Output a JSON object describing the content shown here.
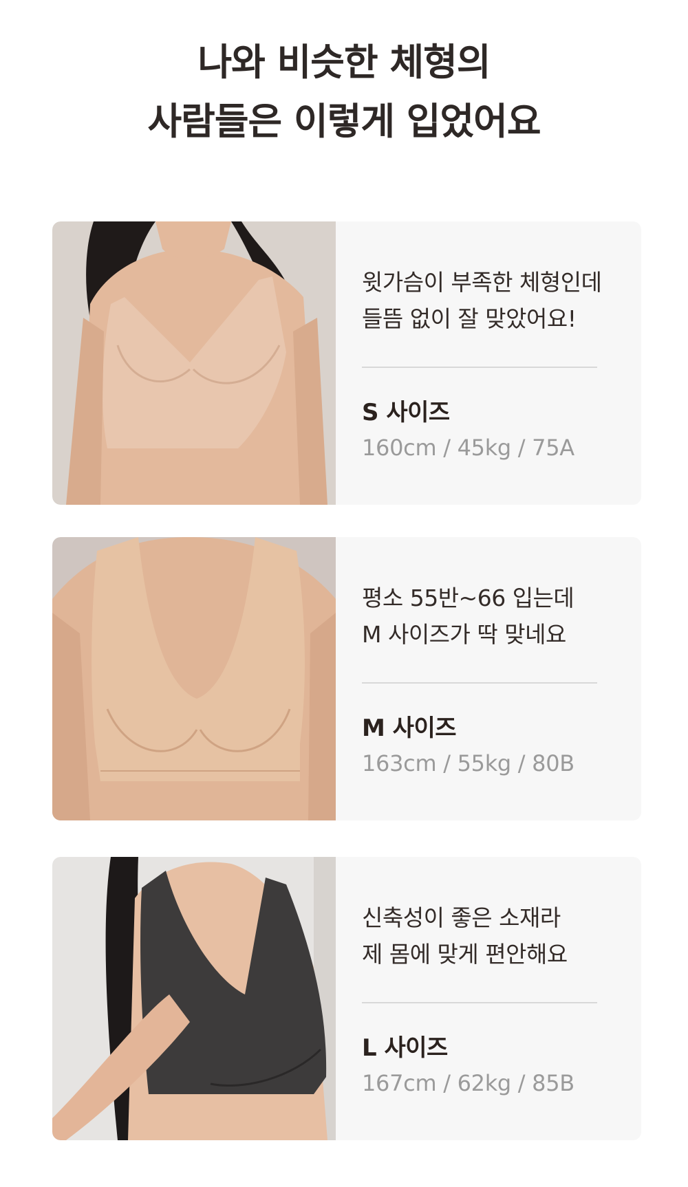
{
  "headline": {
    "line1": "나와 비슷한 체형의",
    "line2": "사람들은 이렇게 입었어요"
  },
  "reviews": [
    {
      "image_alt": "S 사이즈 착용 모델 (베이지)",
      "review_line1": "윗가슴이 부족한 체형인데",
      "review_line2": "들뜸 없이 잘 맞았어요!",
      "size": "S 사이즈",
      "spec": "160cm / 45kg / 75A",
      "garment_color": "#e8c6ae",
      "skin_color": "#e3b99c",
      "bg_color": "#d9d2cc"
    },
    {
      "image_alt": "M 사이즈 착용 모델 (베이지)",
      "review_line1": "평소 55반~66 입는데",
      "review_line2": "M 사이즈가 딱 맞네요",
      "size": "M 사이즈",
      "spec": "163cm / 55kg / 80B",
      "garment_color": "#e6c2a3",
      "skin_color": "#e0b597",
      "bg_color": "#cfc5c0"
    },
    {
      "image_alt": "L 사이즈 착용 모델 (블랙)",
      "review_line1": "신축성이 좋은 소재라",
      "review_line2": "제 몸에 맞게 편안해요",
      "size": "L 사이즈",
      "spec": "167cm / 62kg / 85B",
      "garment_color": "#3d3b3b",
      "skin_color": "#e7bfa3",
      "bg_color": "#e6e4e2"
    }
  ]
}
